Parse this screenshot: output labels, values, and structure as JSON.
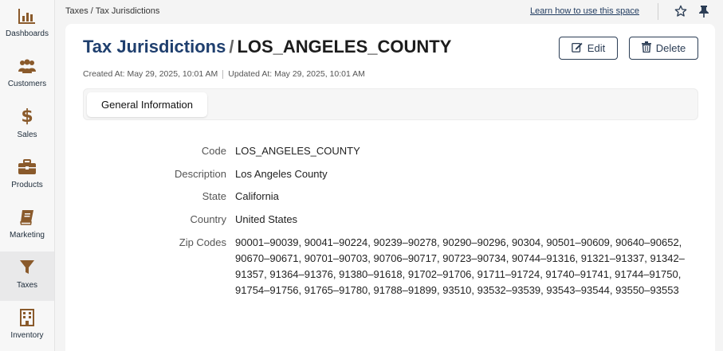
{
  "sidebar": {
    "items": [
      {
        "label": "Dashboards",
        "icon": "bar-chart-icon"
      },
      {
        "label": "Customers",
        "icon": "users-icon"
      },
      {
        "label": "Sales",
        "icon": "dollar-icon"
      },
      {
        "label": "Products",
        "icon": "briefcase-icon"
      },
      {
        "label": "Marketing",
        "icon": "book-icon"
      },
      {
        "label": "Taxes",
        "icon": "funnel-icon",
        "active": true
      },
      {
        "label": "Inventory",
        "icon": "building-icon"
      }
    ]
  },
  "topbar": {
    "breadcrumb": "Taxes / Tax Jurisdictions",
    "learn_link": "Learn how to use this space"
  },
  "header": {
    "parent": "Tax Jurisdictions",
    "separator": "/",
    "current": "LOS_ANGELES_COUNTY",
    "edit_label": "Edit",
    "delete_label": "Delete"
  },
  "meta": {
    "created": "Created At: May 29, 2025, 10:01 AM",
    "updated": "Updated At: May 29, 2025, 10:01 AM"
  },
  "tabs": [
    {
      "label": "General Information",
      "active": true
    }
  ],
  "details": {
    "code_label": "Code",
    "code": "LOS_ANGELES_COUNTY",
    "description_label": "Description",
    "description": "Los Angeles County",
    "state_label": "State",
    "state": "California",
    "country_label": "Country",
    "country": "United States",
    "zip_label": "Zip Codes",
    "zip_codes": "90001–90039, 90041–90224, 90239–90278, 90290–90296, 90304, 90501–90609, 90640–90652, 90670–90671, 90701–90703, 90706–90717, 90723–90734, 90744–91316, 91321–91337, 91342–91357, 91364–91376, 91380–91618, 91702–91706, 91711–91724, 91740–91741, 91744–91750, 91754–91756, 91765–91780, 91788–91899, 93510, 93532–93539, 93543–93544, 93550–93553"
  },
  "colors": {
    "icon_brown": "#8a5a2b",
    "title_blue": "#1f3f6e",
    "button_border": "#2b3d55"
  }
}
